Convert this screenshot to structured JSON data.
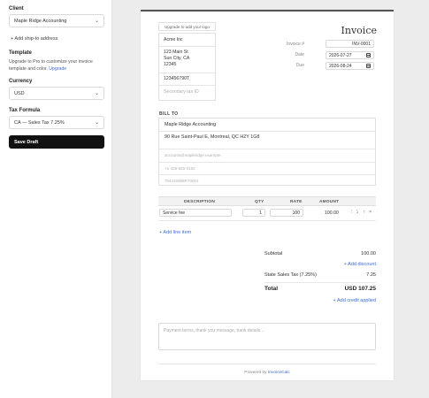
{
  "sidebar": {
    "client_label": "Client",
    "client_value": "Maple Ridge Accounting",
    "add_ship_to": "+ Add ship-to address",
    "template_label": "Template",
    "template_text": "Upgrade to Pro to customize your invoice template and color.",
    "upgrade_link": "Upgrade",
    "currency_label": "Currency",
    "currency_value": "USD",
    "tax_label": "Tax Formula",
    "tax_value": "CA — Sales Tax 7.25%",
    "save_draft": "Save Draft"
  },
  "invoice": {
    "title": "Invoice",
    "logo_placeholder": "Upgrade to add your logo",
    "from": {
      "name": "Acme Inc",
      "street": "123 Main St",
      "city": "Sun City, CA",
      "zip": "12345",
      "tax_id": "123456790T",
      "secondary_tax_placeholder": "Secondary tax ID"
    },
    "meta": {
      "number_label": "Invoice #",
      "number_value": "INV-0001",
      "date_label": "Date",
      "date_value": "2026-07-27",
      "due_label": "Due",
      "due_value": "2026-08-24"
    },
    "bill_to": {
      "label": "BILL TO",
      "name": "Maple Ridge Accounting",
      "address": "90 Rue Saint-Paul E, Montreal, QC H2Y 1G8",
      "email_placeholder": "accounts@mapleridge.example",
      "phone_placeholder": "+1-438-555-0182",
      "tax_placeholder": "704415968RT0001"
    },
    "table": {
      "headers": [
        "DESCRIPTION",
        "QTY",
        "RATE",
        "AMOUNT"
      ],
      "rows": [
        {
          "description": "Service fee",
          "qty": "1",
          "rate": "100",
          "amount": "100.00"
        }
      ],
      "add_line": "+ Add line item"
    },
    "totals": {
      "subtotal_label": "Subtotal",
      "subtotal_value": "100.00",
      "add_discount": "+ Add discount",
      "tax_label": "State Sales Tax (7.25%)",
      "tax_value": "7.25",
      "total_label": "Total",
      "total_value": "USD 107.25",
      "add_credit": "+ Add credit applied"
    },
    "notes_placeholder": "Payment terms, thank you message, bank details...",
    "powered_prefix": "Powered by",
    "powered_brand": "InvoiceCalc"
  }
}
